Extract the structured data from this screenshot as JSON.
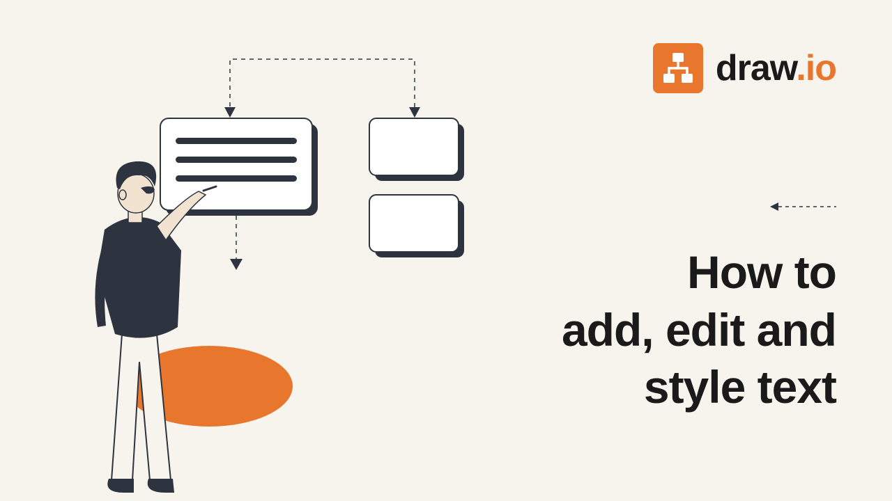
{
  "brand": {
    "name_prefix": "draw",
    "name_suffix": ".io"
  },
  "title": {
    "line1": "How to",
    "line2": "add, edit and",
    "line3": "style text"
  },
  "colors": {
    "accent": "#e8762d",
    "ink": "#2d3440",
    "bg": "#f7f3ed"
  },
  "illustration": {
    "description": "person drawing on diagram cards with dashed connectors",
    "cards": 3
  }
}
